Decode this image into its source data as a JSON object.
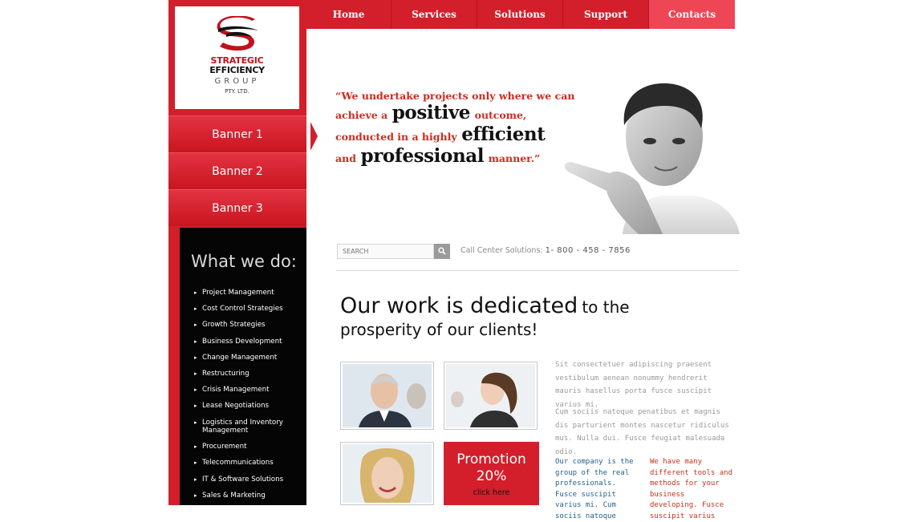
{
  "colors": {
    "brand_red": "#d31f2b",
    "nav_active": "#ef4655",
    "panel_black": "#050505",
    "quote_orange": "#cf2a1d",
    "text_blue": "#1f5f8e",
    "text_red": "#c9301c"
  },
  "logo": {
    "line1": "STRATEGIC",
    "line2": "EFFICIENCY",
    "line3": "GROUP",
    "line4": "PTY. LTD."
  },
  "nav": {
    "home": "Home",
    "services": "Services",
    "solutions": "Solutions",
    "support": "Support",
    "contacts": "Contacts",
    "active": "Contacts"
  },
  "banners": [
    "Banner 1",
    "Banner 2",
    "Banner 3"
  ],
  "what_we_do": {
    "title": "What we do:",
    "items": [
      "Project Management",
      "Cost Control Strategies",
      "Growth Strategies",
      "Business Development",
      "Change Management",
      "Restructuring",
      "Crisis Management",
      "Lease Negotiations",
      "Logistics and Inventory Management",
      "Procurement",
      "Telecommunications",
      "IT & Software Solutions",
      "Sales & Marketing"
    ]
  },
  "hero": {
    "l1": "“We undertake projects only where we can",
    "l2a": "achieve a",
    "l2b": "positive",
    "l2c": "outcome,",
    "l3a": "conducted in a highly",
    "l3b": "efficient",
    "l4a": "and",
    "l4b": "professional",
    "l4c": "manner.”"
  },
  "search": {
    "placeholder": "SEARCH",
    "icon": "search-icon"
  },
  "callcenter": {
    "label": "Call Center Solutions:",
    "phone": "1- 800 - 458 - 7856"
  },
  "headline": {
    "part1": "Our work is dedicated",
    "part2": "to the",
    "line2": "prosperity of our clients!"
  },
  "promo": {
    "title": "Promotion",
    "percent": "20%",
    "cta": "click here"
  },
  "content": {
    "para1": "Sit consectetuer adipiscing praesent vestibulum aenean nonummy hendrerit mauris hasellus porta fusce suscipit varius mi.",
    "para2": "Cum sociis natoque penatibus et magnis dis parturient montes nascetur ridiculus mus. Nulla dui. Fusce feugiat malesuada odio.",
    "col_blue": "Our company is the group of the real professionals. Fusce suscipit varius mi. Cum sociis natoque",
    "col_red": "We have many different tools and methods for your business developing. Fusce suscipit varius"
  }
}
